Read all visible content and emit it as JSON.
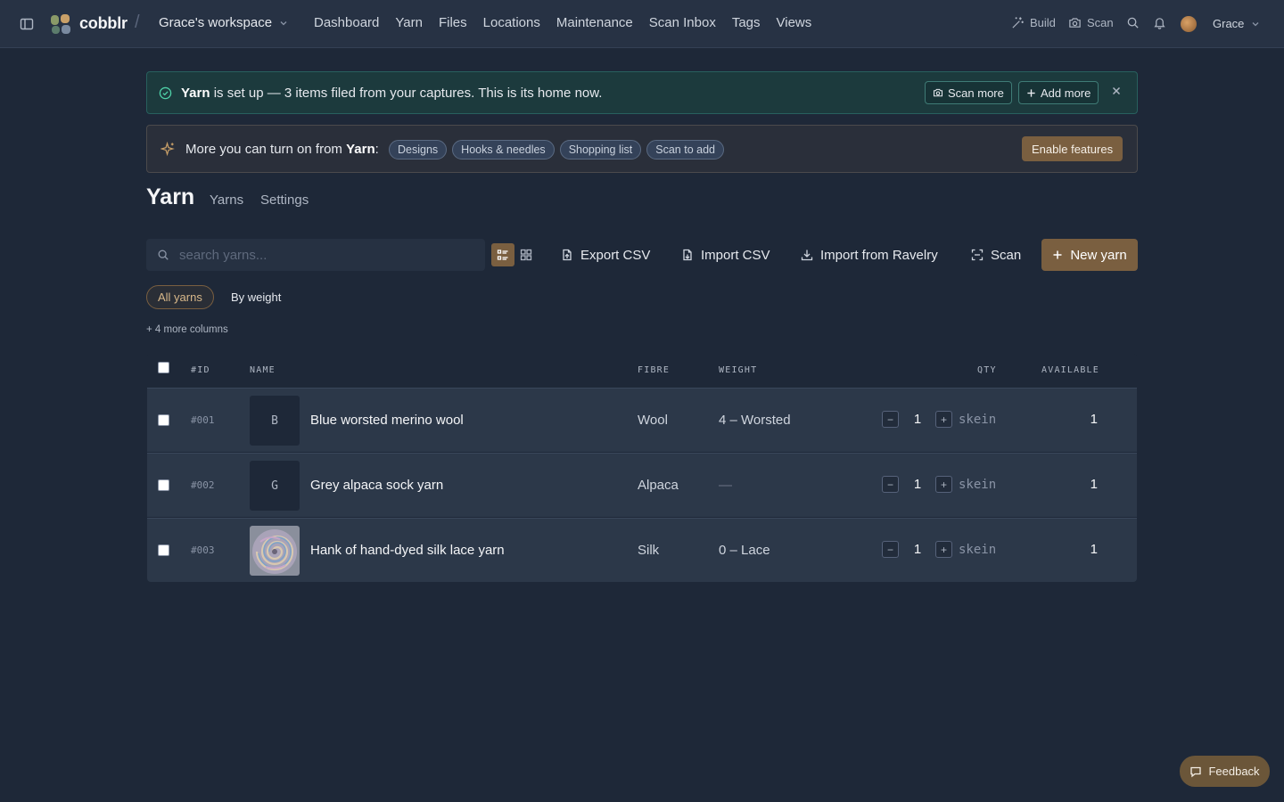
{
  "app": {
    "brand": "cobblr",
    "workspace": "Grace's workspace",
    "user": "Grace"
  },
  "nav": [
    "Dashboard",
    "Yarn",
    "Files",
    "Locations",
    "Maintenance",
    "Scan Inbox",
    "Tags",
    "Views"
  ],
  "tools": {
    "build": "Build",
    "scan": "Scan"
  },
  "success_banner": {
    "bold": "Yarn",
    "text": " is set up — 3 items filed from your captures. This is its home now.",
    "scan_more": "Scan more",
    "add_more": "Add more"
  },
  "features_banner": {
    "prefix": "More you can turn on from ",
    "bold": "Yarn",
    "suffix": ":",
    "chips": [
      "Designs",
      "Hooks & needles",
      "Shopping list",
      "Scan to add"
    ],
    "enable": "Enable features"
  },
  "page": {
    "title": "Yarn",
    "tabs": [
      "Yarns",
      "Settings"
    ]
  },
  "toolbar": {
    "search_placeholder": "search yarns...",
    "export_csv": "Export CSV",
    "import_csv": "Import CSV",
    "import_ravelry": "Import from Ravelry",
    "scan": "Scan",
    "new": "New yarn"
  },
  "filters": {
    "all": "All yarns",
    "by_weight": "By weight"
  },
  "more_columns": "+ 4 more columns",
  "table": {
    "headers": {
      "id": "#ID",
      "name": "NAME",
      "fibre": "FIBRE",
      "weight": "WEIGHT",
      "qty": "QTY",
      "available": "AVAILABLE"
    },
    "rows": [
      {
        "id": "#001",
        "thumb": "B",
        "name": "Blue worsted merino wool",
        "fibre": "Wool",
        "weight": "4 – Worsted",
        "qty": "1",
        "unit": "skein",
        "available": "1"
      },
      {
        "id": "#002",
        "thumb": "G",
        "name": "Grey alpaca sock yarn",
        "fibre": "Alpaca",
        "weight": "—",
        "qty": "1",
        "unit": "skein",
        "available": "1"
      },
      {
        "id": "#003",
        "thumb": "",
        "name": "Hank of hand-dyed silk lace yarn",
        "fibre": "Silk",
        "weight": "0 – Lace",
        "qty": "1",
        "unit": "skein",
        "available": "1"
      }
    ]
  },
  "feedback": "Feedback",
  "colors": {
    "background": "#1e2838",
    "accent": "#7a5f40",
    "success": "#4fd1a8",
    "surface": "#2c3849"
  }
}
